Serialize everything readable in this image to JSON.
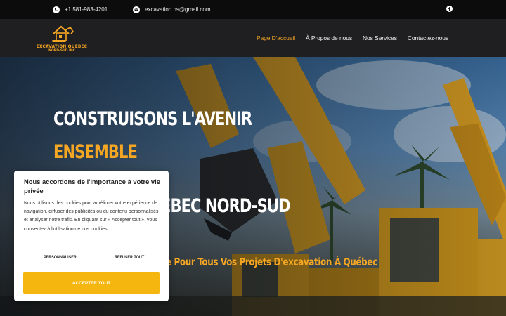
{
  "topbar": {
    "phone": "+1 581-983-4201",
    "email": "excavation.ns@gmail.com",
    "icons": [
      "phone-icon",
      "mail-icon",
      "facebook-icon"
    ]
  },
  "header": {
    "logo_line1": "EXCAVATION QUÉBEC",
    "logo_line2": "NORD-SUD INC",
    "nav": [
      {
        "label": "Page D'accueil",
        "active": true
      },
      {
        "label": "À Propos de nous",
        "active": false
      },
      {
        "label": "Nos Services",
        "active": false
      },
      {
        "label": "Contactez-nous",
        "active": false
      }
    ]
  },
  "hero": {
    "line1": "CONSTRUISONS L'AVENIR",
    "line2": "ENSEMBLE",
    "line3_visible": "ÉBEC NORD-SUD",
    "tagline_visible": "e Pour Tous Vos Projets D'excavation À Québec"
  },
  "cookie": {
    "title": "Nous accordons de l'importance à votre vie privée",
    "body": "Nous utilisons des cookies pour améliorer votre expérience de navigation, diffuser des publicités ou du contenu personnalisés et analyser notre trafic. En cliquant sur « Accepter tout », vous consentez à l'utilisation de nos cookies.",
    "customize_label": "PERSONNALISER",
    "reject_label": "REFUSER TOUT",
    "accept_label": "ACCEPTER TOUT"
  },
  "colors": {
    "accent": "#f5a623",
    "button": "#f5b60f",
    "topbar_bg": "#0c0c0c",
    "header_bg": "#1f1f22"
  }
}
